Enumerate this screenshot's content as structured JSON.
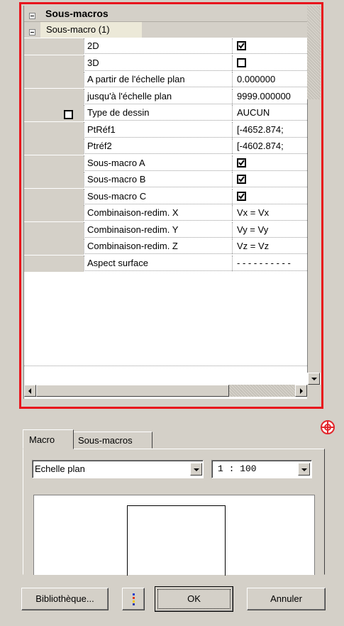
{
  "section": {
    "title": "Sous-macros"
  },
  "subsection": {
    "title": "Sous-macro (1)"
  },
  "properties": [
    {
      "name": "2D",
      "value": "",
      "checkbox": "checked",
      "gutter_checkbox": false
    },
    {
      "name": "3D",
      "value": "",
      "checkbox": "unchecked",
      "gutter_checkbox": false
    },
    {
      "name": "A partir de l'échelle plan",
      "value": "0.000000",
      "checkbox": "none",
      "gutter_checkbox": false
    },
    {
      "name": "jusqu'à l'échelle plan",
      "value": "9999.000000",
      "checkbox": "none",
      "gutter_checkbox": false
    },
    {
      "name": "Type de dessin",
      "value": "AUCUN",
      "checkbox": "none",
      "gutter_checkbox": true
    },
    {
      "name": "PtRéf1",
      "value": "[-4652.874;",
      "checkbox": "none",
      "gutter_checkbox": false
    },
    {
      "name": "Ptréf2",
      "value": "[-4602.874;",
      "checkbox": "none",
      "gutter_checkbox": false
    },
    {
      "name": "Sous-macro A",
      "value": "",
      "checkbox": "checked",
      "gutter_checkbox": false
    },
    {
      "name": "Sous-macro B",
      "value": "",
      "checkbox": "checked",
      "gutter_checkbox": false
    },
    {
      "name": "Sous-macro C",
      "value": "",
      "checkbox": "checked",
      "gutter_checkbox": false
    },
    {
      "name": "Combinaison-redim. X",
      "value": "Vx = Vx",
      "checkbox": "none",
      "gutter_checkbox": false
    },
    {
      "name": "Combinaison-redim. Y",
      "value": "Vy = Vy",
      "checkbox": "none",
      "gutter_checkbox": false
    },
    {
      "name": "Combinaison-redim. Z",
      "value": "Vz = Vz",
      "checkbox": "none",
      "gutter_checkbox": false
    },
    {
      "name": "Aspect surface",
      "value": "- - - - - - - - - -",
      "checkbox": "none",
      "gutter_checkbox": false
    }
  ],
  "tabs": [
    {
      "label": "Macro",
      "active": true
    },
    {
      "label": "Sous-macros",
      "active": false
    }
  ],
  "scale_type": {
    "value": "Echelle plan"
  },
  "scale_ratio": {
    "value": "1 : 100"
  },
  "buttons": {
    "library": "Bibliothèque...",
    "ok": "OK",
    "cancel": "Annuler"
  },
  "colors": {
    "highlight_border": "#e8141c",
    "window_bg": "#d4d0c8",
    "help_icon": "#e2262b"
  },
  "icons": {
    "help": "lifebuoy-icon",
    "color_picker": "color-dots-icon"
  }
}
